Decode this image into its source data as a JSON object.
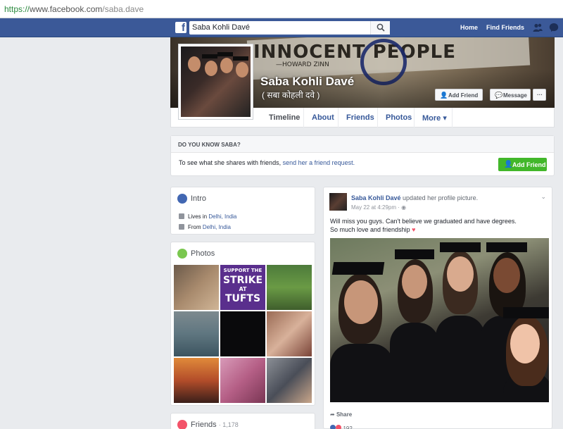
{
  "browser": {
    "url_scheme": "https://",
    "url_host": "www.facebook.com",
    "url_path": "/saba.dave"
  },
  "topnav": {
    "search_value": "Saba Kohli Davé",
    "home": "Home",
    "find_friends": "Find Friends"
  },
  "cover": {
    "slogan": "INNOCENT PEOPLE",
    "slogan_credit": "—HOWARD ZINN",
    "name": "Saba Kohli Davé",
    "alt_name": "( सबा कोहली दवे )",
    "add_friend": "Add Friend",
    "message": "Message",
    "more": "···"
  },
  "tabs": [
    "Timeline",
    "About",
    "Friends",
    "Photos",
    "More ▾"
  ],
  "know": {
    "title": "DO YOU KNOW SABA?",
    "message_prefix": "To see what she shares with friends,",
    "message_link": "send her a friend request.",
    "button": "Add Friend"
  },
  "intro": {
    "title": "Intro",
    "lives_prefix": "Lives in",
    "lives_place": "Delhi, India",
    "from_prefix": "From",
    "from_place": "Delhi, India"
  },
  "photos": {
    "title": "Photos",
    "strike_text": [
      "SUPPORT THE",
      "STRIKE",
      "AT",
      "TUFTS"
    ]
  },
  "friends": {
    "title": "Friends",
    "count": "· 1,178"
  },
  "post": {
    "author": "Saba Kohli Davé",
    "action": "updated her profile picture.",
    "date": "May 22 at 4:29pm ·",
    "text1": "Will miss you guys. Can't believe we graduated and have degrees.",
    "text2": "So much love and friendship",
    "share": "Share",
    "reactions": "192"
  },
  "colors": {
    "brand": "#3b5998",
    "green": "#42b72a",
    "link": "#365899"
  }
}
